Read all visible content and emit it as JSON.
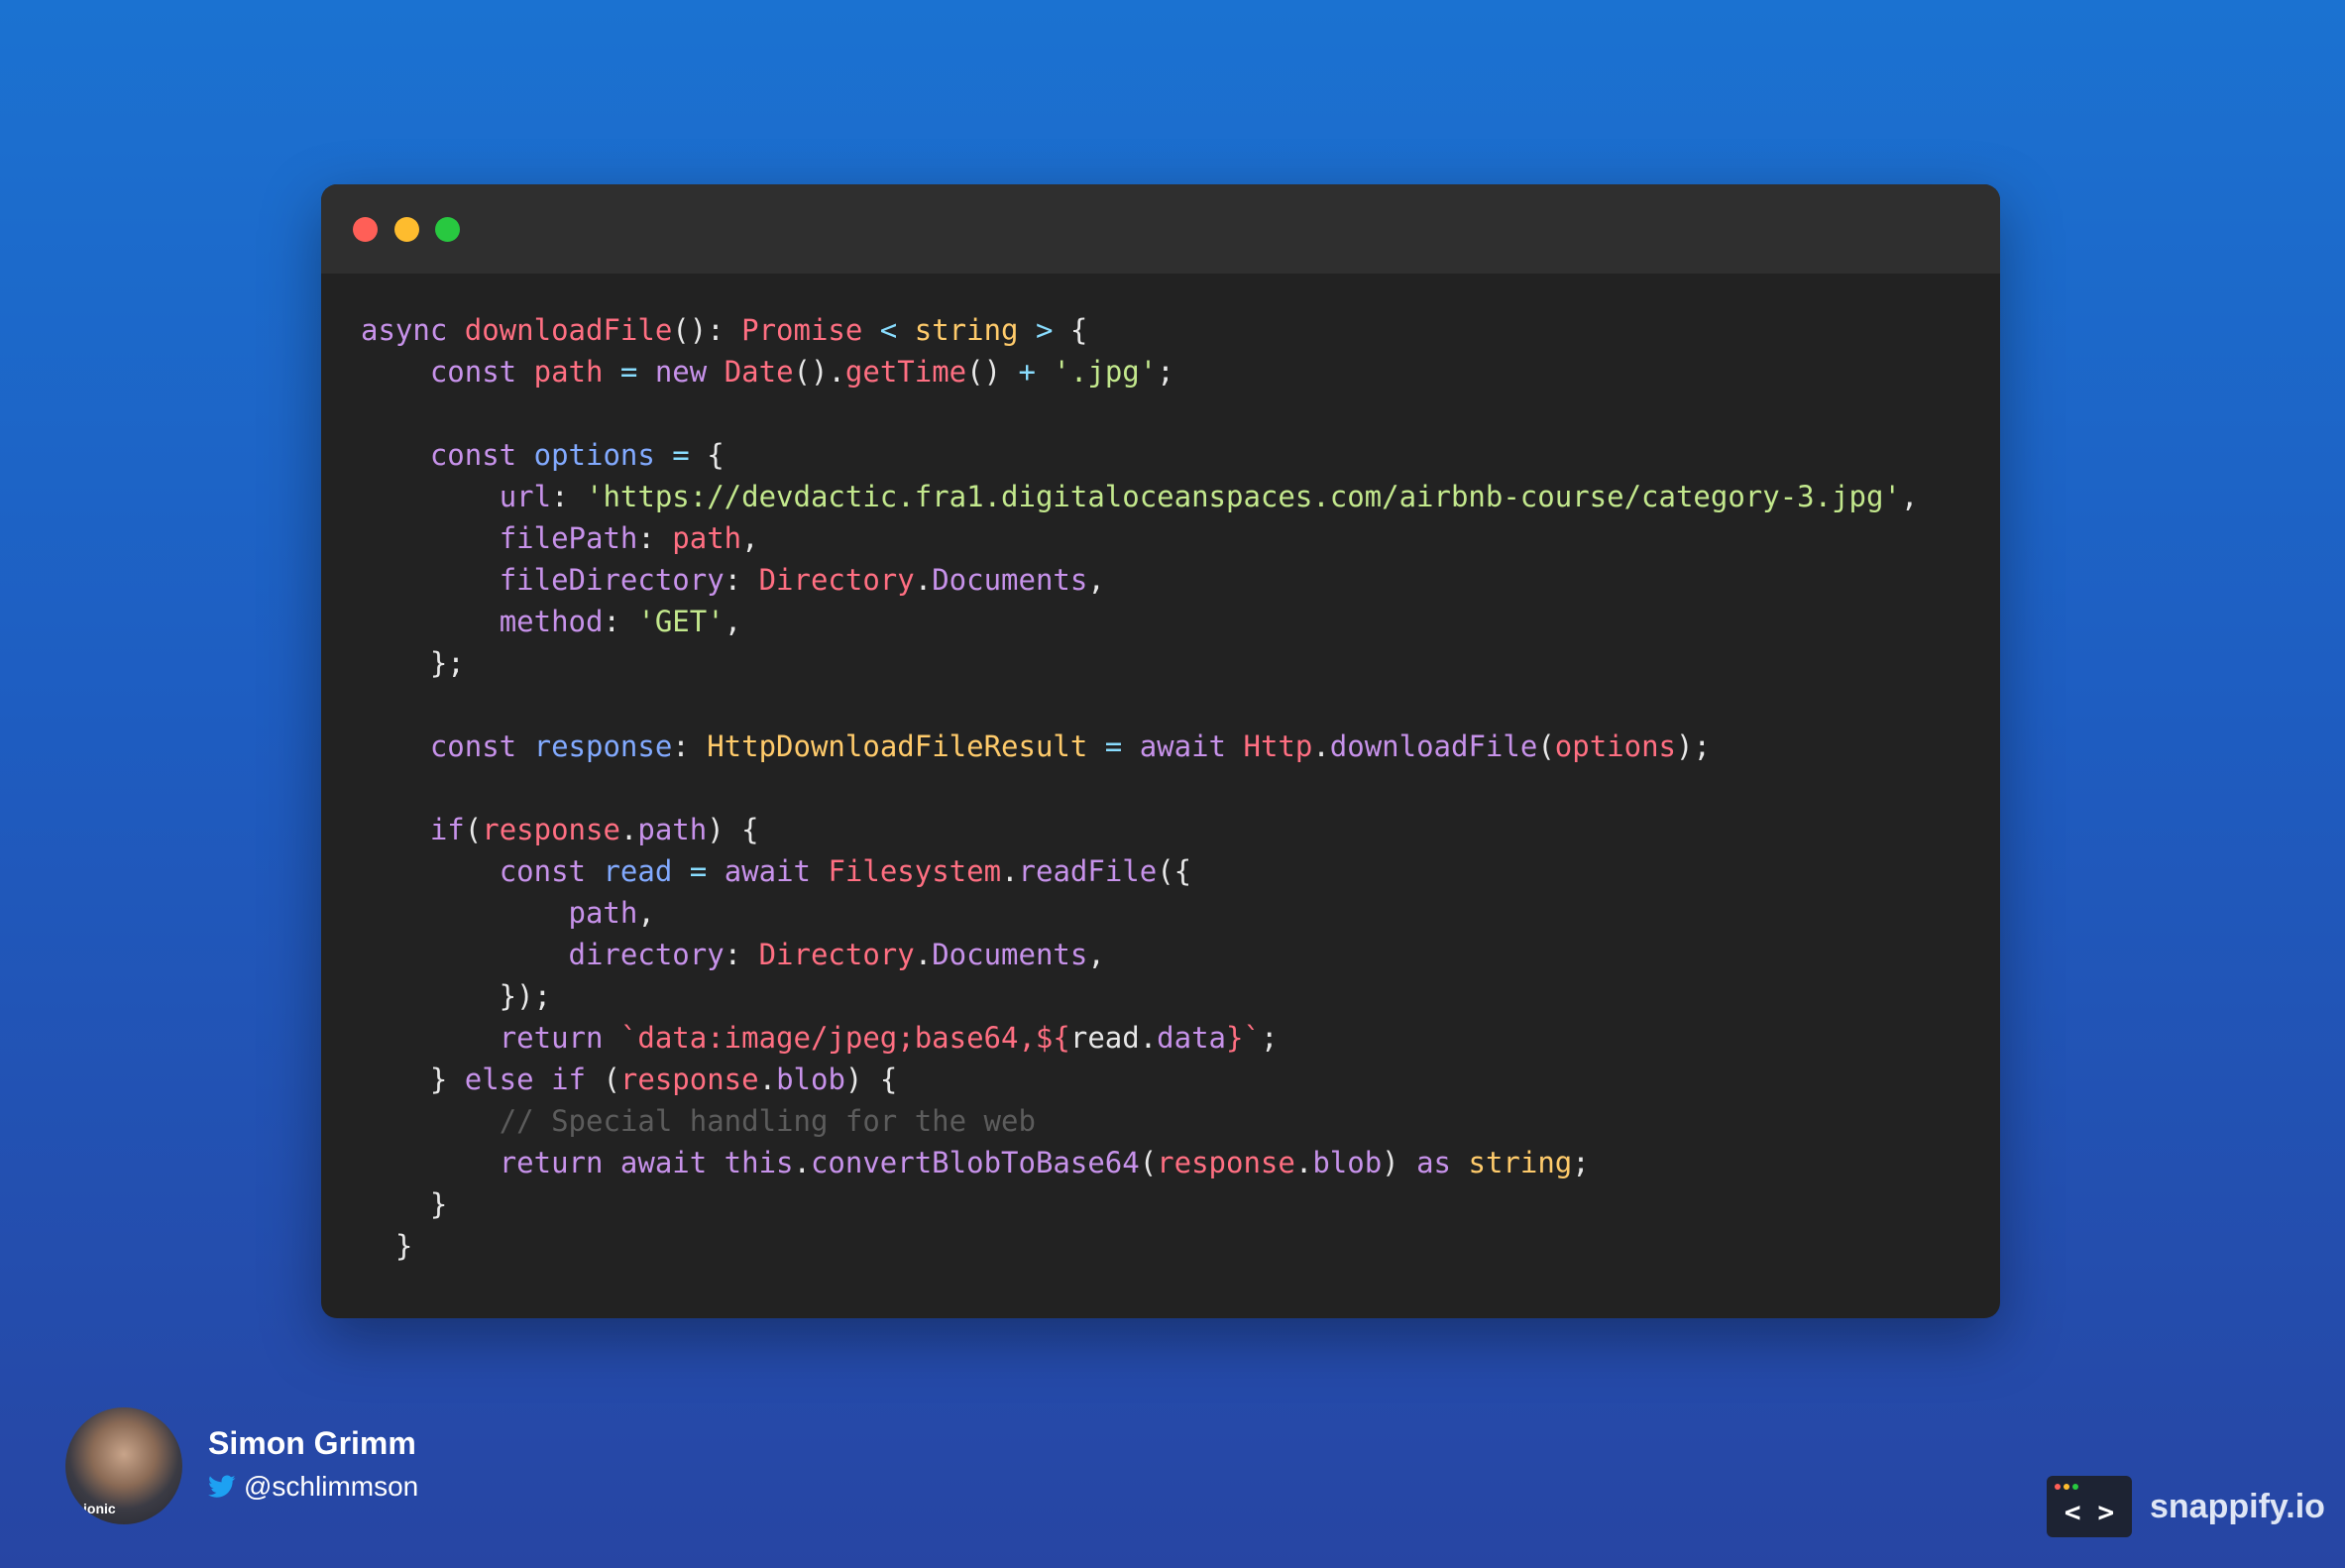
{
  "window": {
    "controls": [
      "close",
      "minimize",
      "maximize"
    ],
    "code_lines": [
      [
        [
          "kw",
          "async "
        ],
        [
          "fn",
          "downloadFile"
        ],
        [
          "pl",
          "(): "
        ],
        [
          "fn",
          "Promise"
        ],
        [
          "op",
          " < "
        ],
        [
          "ty",
          "string"
        ],
        [
          "op",
          " > "
        ],
        [
          "pl",
          "{"
        ]
      ],
      [
        [
          "pl",
          "    "
        ],
        [
          "kw",
          "const "
        ],
        [
          "fn",
          "path"
        ],
        [
          "op",
          " = "
        ],
        [
          "kw",
          "new "
        ],
        [
          "fn",
          "Date"
        ],
        [
          "pl",
          "()."
        ],
        [
          "fn",
          "getTime"
        ],
        [
          "pl",
          "() "
        ],
        [
          "op",
          "+ "
        ],
        [
          "str",
          "'.jpg'"
        ],
        [
          "pl",
          ";"
        ]
      ],
      [],
      [
        [
          "pl",
          "    "
        ],
        [
          "kw",
          "const "
        ],
        [
          "var",
          "options"
        ],
        [
          "op",
          " = "
        ],
        [
          "pl",
          "{"
        ]
      ],
      [
        [
          "pl",
          "        "
        ],
        [
          "prop",
          "url"
        ],
        [
          "pl",
          ": "
        ],
        [
          "str",
          "'https://devdactic.fra1.digitaloceanspaces.com/airbnb-course/category-3.jpg'"
        ],
        [
          "pl",
          ","
        ]
      ],
      [
        [
          "pl",
          "        "
        ],
        [
          "prop",
          "filePath"
        ],
        [
          "pl",
          ": "
        ],
        [
          "fn",
          "path"
        ],
        [
          "pl",
          ","
        ]
      ],
      [
        [
          "pl",
          "        "
        ],
        [
          "prop",
          "fileDirectory"
        ],
        [
          "pl",
          ": "
        ],
        [
          "obj",
          "Directory"
        ],
        [
          "pl",
          "."
        ],
        [
          "prop",
          "Documents"
        ],
        [
          "pl",
          ","
        ]
      ],
      [
        [
          "pl",
          "        "
        ],
        [
          "prop",
          "method"
        ],
        [
          "pl",
          ": "
        ],
        [
          "str",
          "'GET'"
        ],
        [
          "pl",
          ","
        ]
      ],
      [
        [
          "pl",
          "    };"
        ]
      ],
      [],
      [
        [
          "pl",
          "    "
        ],
        [
          "kw",
          "const "
        ],
        [
          "var",
          "response"
        ],
        [
          "pl",
          ": "
        ],
        [
          "ty",
          "HttpDownloadFileResult"
        ],
        [
          "op",
          " = "
        ],
        [
          "kw",
          "await "
        ],
        [
          "obj",
          "Http"
        ],
        [
          "pl",
          "."
        ],
        [
          "prop",
          "downloadFile"
        ],
        [
          "pl",
          "("
        ],
        [
          "fn",
          "options"
        ],
        [
          "pl",
          ");"
        ]
      ],
      [],
      [
        [
          "pl",
          "    "
        ],
        [
          "kw",
          "if"
        ],
        [
          "pl",
          "("
        ],
        [
          "fn",
          "response"
        ],
        [
          "pl",
          "."
        ],
        [
          "prop",
          "path"
        ],
        [
          "pl",
          ") {"
        ]
      ],
      [
        [
          "pl",
          "        "
        ],
        [
          "kw",
          "const "
        ],
        [
          "var",
          "read"
        ],
        [
          "op",
          " = "
        ],
        [
          "kw",
          "await "
        ],
        [
          "obj",
          "Filesystem"
        ],
        [
          "pl",
          "."
        ],
        [
          "prop",
          "readFile"
        ],
        [
          "pl",
          "({"
        ]
      ],
      [
        [
          "pl",
          "            "
        ],
        [
          "prop",
          "path"
        ],
        [
          "pl",
          ","
        ]
      ],
      [
        [
          "pl",
          "            "
        ],
        [
          "prop",
          "directory"
        ],
        [
          "pl",
          ": "
        ],
        [
          "obj",
          "Directory"
        ],
        [
          "pl",
          "."
        ],
        [
          "prop",
          "Documents"
        ],
        [
          "pl",
          ","
        ]
      ],
      [
        [
          "pl",
          "        });"
        ]
      ],
      [
        [
          "pl",
          "        "
        ],
        [
          "kw",
          "return "
        ],
        [
          "tpl",
          "`data:image/jpeg;base64,${"
        ],
        [
          "pl",
          "read."
        ],
        [
          "prop",
          "data"
        ],
        [
          "tpl",
          "}`"
        ],
        [
          "pl",
          ";"
        ]
      ],
      [
        [
          "pl",
          "    } "
        ],
        [
          "kw",
          "else if "
        ],
        [
          "pl",
          "("
        ],
        [
          "fn",
          "response"
        ],
        [
          "pl",
          "."
        ],
        [
          "prop",
          "blob"
        ],
        [
          "pl",
          ") {"
        ]
      ],
      [
        [
          "pl",
          "        "
        ],
        [
          "cm",
          "// Special handling for the web"
        ]
      ],
      [
        [
          "pl",
          "        "
        ],
        [
          "kw",
          "return await this"
        ],
        [
          "pl",
          "."
        ],
        [
          "prop",
          "convertBlobToBase64"
        ],
        [
          "pl",
          "("
        ],
        [
          "fn",
          "response"
        ],
        [
          "pl",
          "."
        ],
        [
          "prop",
          "blob"
        ],
        [
          "pl",
          ") "
        ],
        [
          "kw",
          "as "
        ],
        [
          "ty",
          "string"
        ],
        [
          "pl",
          ";"
        ]
      ],
      [
        [
          "pl",
          "    }"
        ]
      ],
      [
        [
          "pl",
          "  }"
        ]
      ]
    ]
  },
  "colors": {
    "keyword": "#c792ea",
    "function": "#ff6f82",
    "type": "#ffcb6b",
    "operator": "#89ddff",
    "string": "#c3e88d",
    "variable": "#82aaff",
    "comment": "#5c5c5c"
  },
  "author": {
    "name": "Simon Grimm",
    "handle": "@schlimmson",
    "avatar_badge": "ionic",
    "handle_icon": "twitter-bird-icon"
  },
  "brand": {
    "name": "snappify.io",
    "logo_glyph": "< >"
  }
}
